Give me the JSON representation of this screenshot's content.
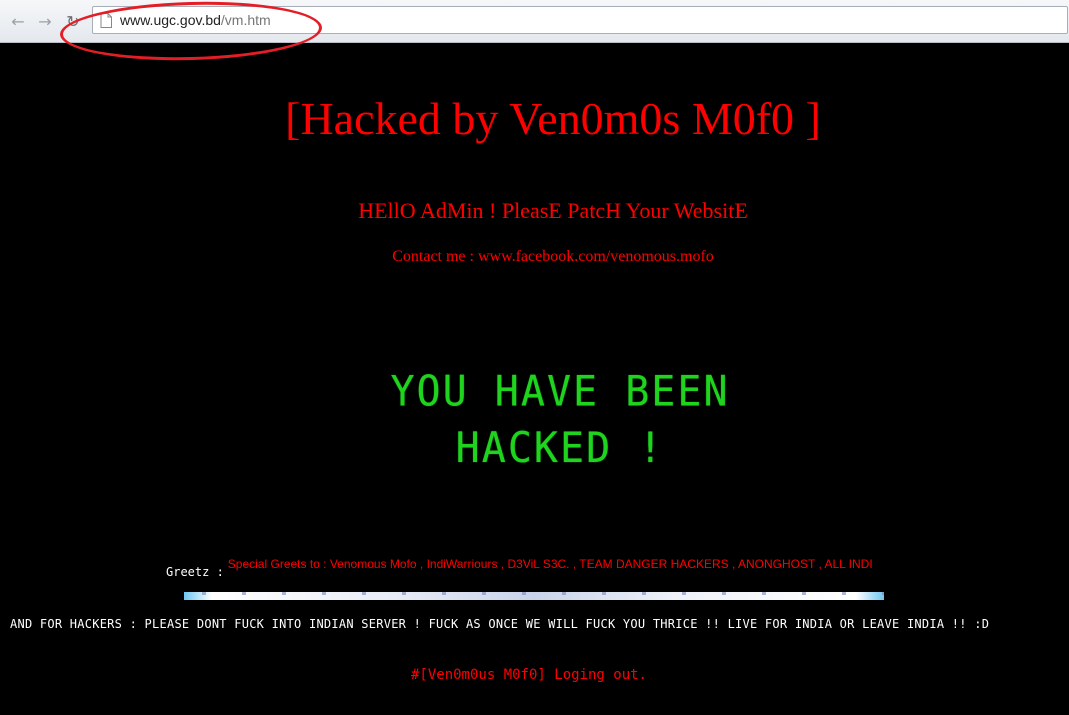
{
  "browser": {
    "url_host": "www.ugc.gov.bd",
    "url_path": "/vm.htm",
    "back_icon": "back-arrow-icon",
    "forward_icon": "forward-arrow-icon",
    "reload_icon": "reload-icon",
    "page_icon": "document-icon",
    "annotation_color": "#e41e26"
  },
  "page": {
    "title": "[Hacked by Ven0m0s M0f0 ]",
    "subtitle": "HEllO AdMin ! PleasE PatcH Your WebsitE",
    "contact": "Contact me : www.facebook.com/venomous.mofo",
    "big_line1": "YOU HAVE BEEN",
    "big_line2": "HACKED !",
    "greetz_label": "Greetz :",
    "greets_text": "Special Greets to : Venomous Mofo , IndiWarriours , D3ViL S3C. , TEAM DANGER HACKERS , ANONGHOST , ALL INDI",
    "warning": "AND FOR HACKERS : PLEASE DONT FUCK INTO INDIAN SERVER ! FUCK AS ONCE WE WILL FUCK YOU THRICE !! LIVE FOR INDIA OR LEAVE INDIA !! :D",
    "logout": "#[Ven0m0us M0f0] Loging out."
  },
  "colors": {
    "background": "#000000",
    "red_text": "#ff0000",
    "green_text": "#1fd31f",
    "white_text": "#ffffff"
  }
}
